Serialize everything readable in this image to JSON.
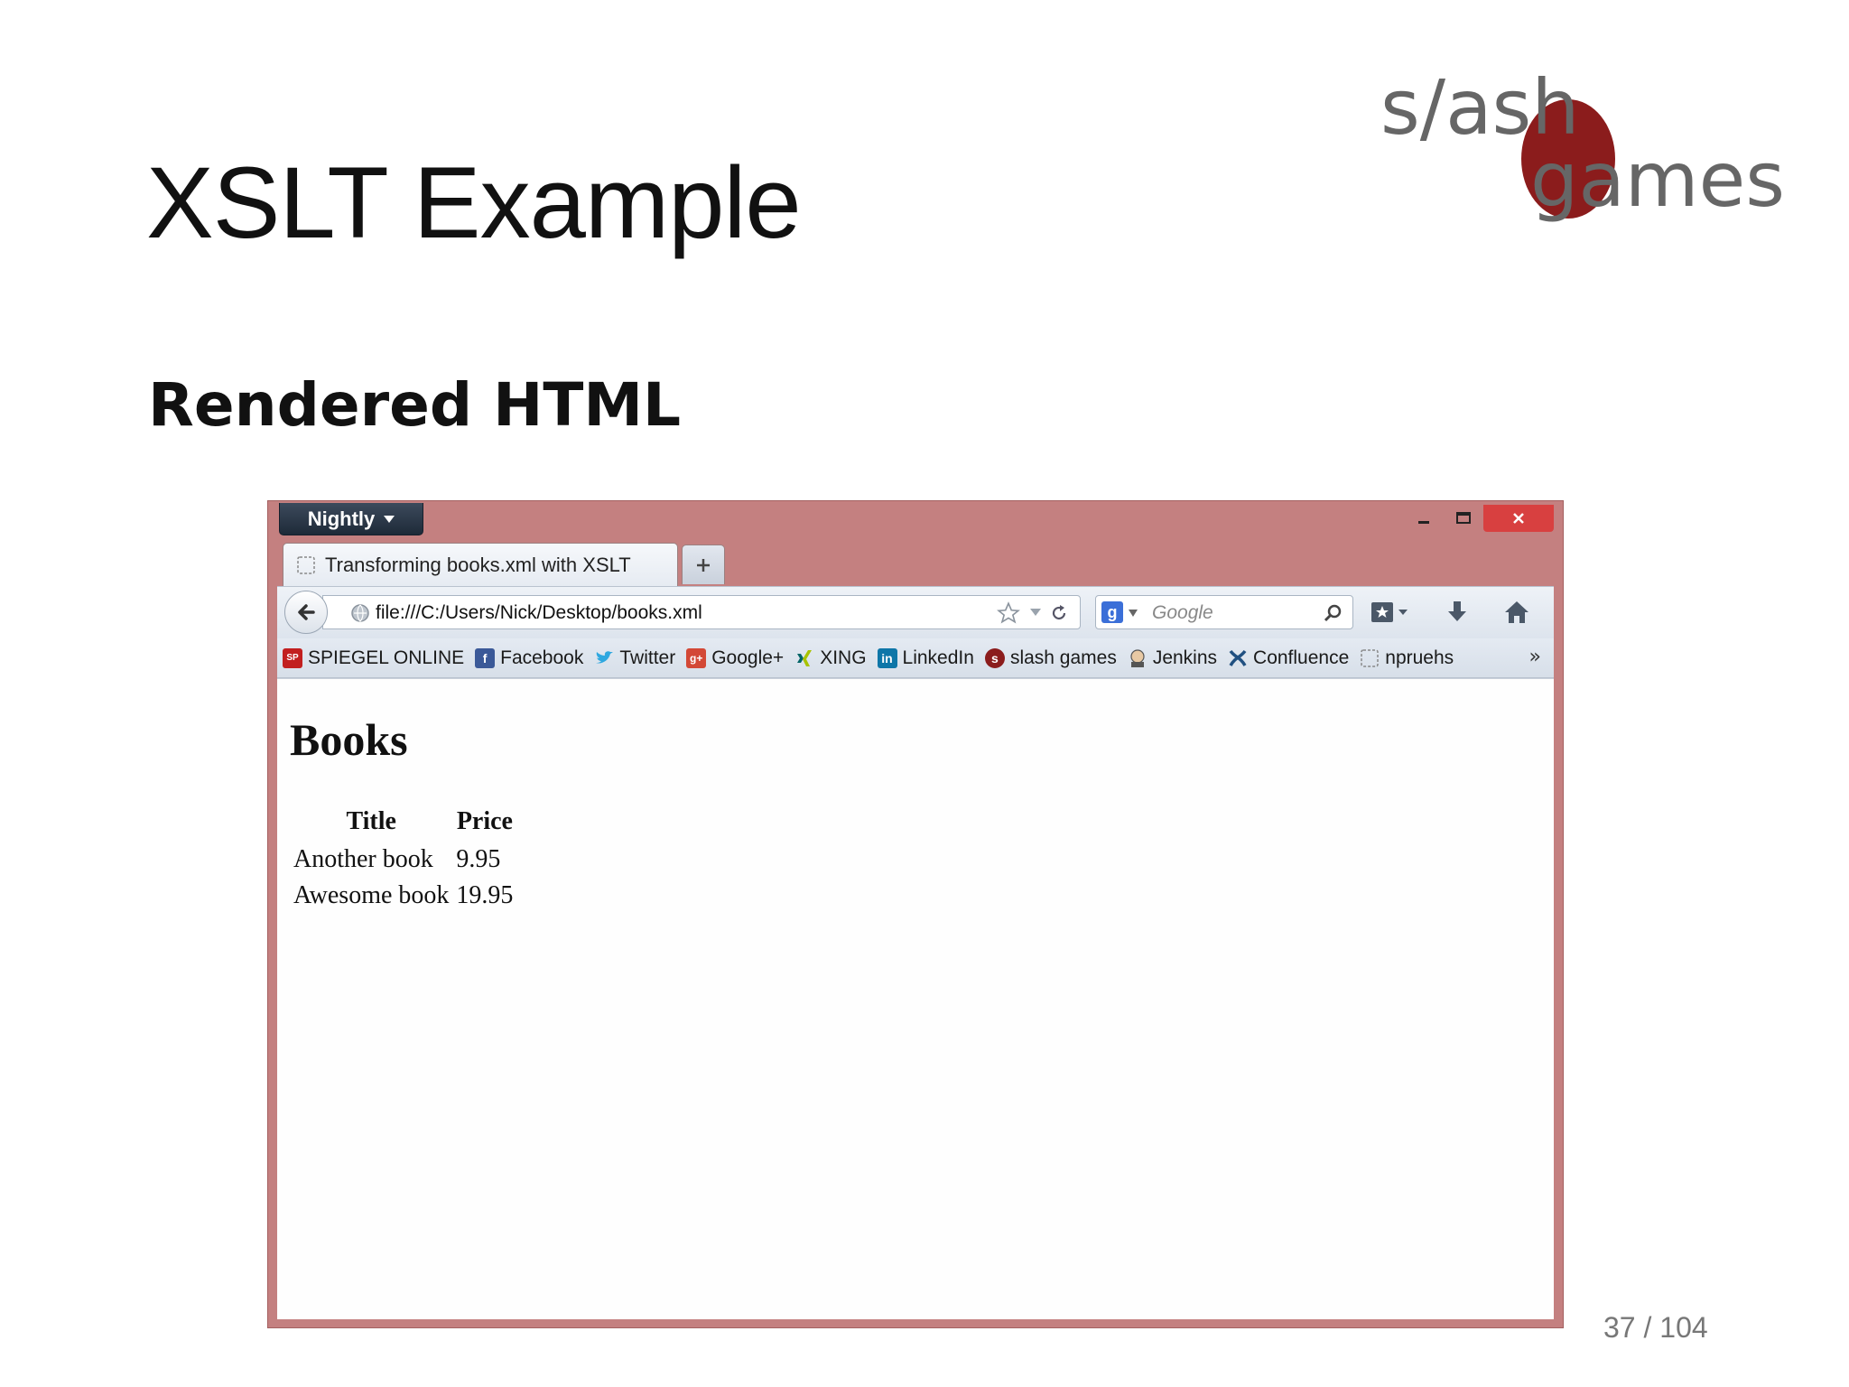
{
  "slide": {
    "title": "XSLT Example",
    "subtitle": "Rendered HTML",
    "page_number": "37 / 104"
  },
  "logo": {
    "top_text": "s/ash",
    "bottom_text": "games",
    "brand_color": "#8b1c1c",
    "text_color": "#666666"
  },
  "browser": {
    "app_button_label": "Nightly",
    "tab_title": "Transforming books.xml with XSLT",
    "url": "file:///C:/Users/Nick/Desktop/books.xml",
    "search_placeholder": "Google",
    "bookmarks": [
      {
        "label": "SPIEGEL ONLINE",
        "icon": "spiegel-icon",
        "color": "#c21f1f"
      },
      {
        "label": "Facebook",
        "icon": "facebook-icon",
        "color": "#3b5998"
      },
      {
        "label": "Twitter",
        "icon": "twitter-icon",
        "color": "#2fa8e0"
      },
      {
        "label": "Google+",
        "icon": "google-plus-icon",
        "color": "#d34836"
      },
      {
        "label": "XING",
        "icon": "xing-icon",
        "color": "#006567"
      },
      {
        "label": "LinkedIn",
        "icon": "linkedin-icon",
        "color": "#0e76a8"
      },
      {
        "label": "slash games",
        "icon": "slash-games-icon",
        "color": "#8b1c1c"
      },
      {
        "label": "Jenkins",
        "icon": "jenkins-icon",
        "color": "#c8a27a"
      },
      {
        "label": "Confluence",
        "icon": "confluence-icon",
        "color": "#205081"
      },
      {
        "label": "npruehs",
        "icon": "blank-page-icon",
        "color": "#ffffff"
      }
    ]
  },
  "page": {
    "heading": "Books",
    "table": {
      "headers": [
        "Title",
        "Price"
      ],
      "rows": [
        [
          "Another book",
          "9.95"
        ],
        [
          "Awesome book",
          "19.95"
        ]
      ]
    }
  }
}
